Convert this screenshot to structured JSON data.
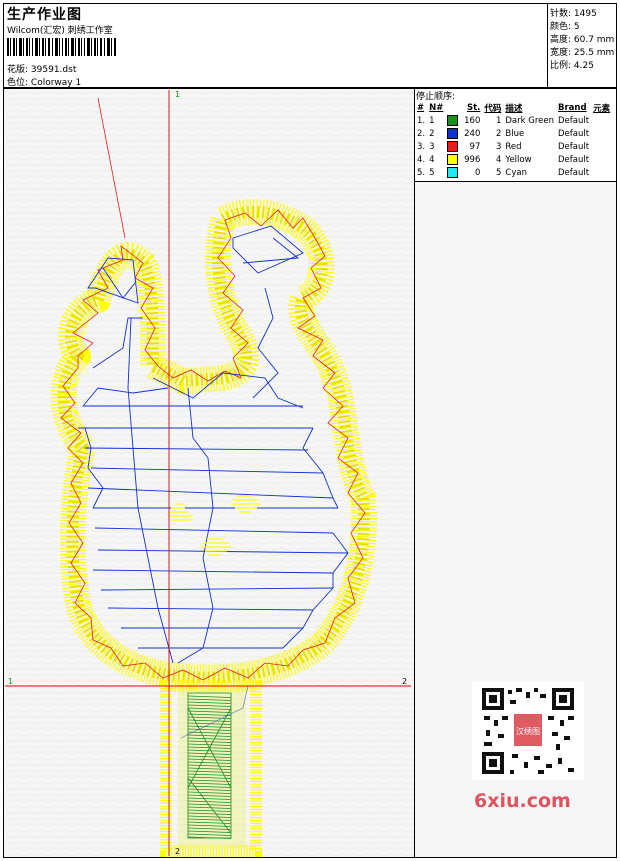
{
  "header": {
    "title": "生产作业图",
    "studio": "Wilcom(汇宏) 刺绣工作室",
    "design_label": "花版:",
    "design_file": "39591.dst",
    "colorway_label": "色位:",
    "colorway": "Colorway 1"
  },
  "stats": {
    "stitches": "针数: 1495",
    "colors": "颜色: 5",
    "height": "高度: 60.7 mm",
    "width": "宽度: 25.5 mm",
    "scale": "比例: 4.25"
  },
  "legend": {
    "title": "停止顺序:",
    "columns": [
      "#",
      "N#",
      "St.",
      "代码",
      "描述",
      "Brand",
      "元素"
    ],
    "rows": [
      {
        "idx": "1.",
        "n": "1",
        "color": "#1a8f1a",
        "st": "160",
        "code": "1",
        "desc": "Dark Green",
        "brand": "Default"
      },
      {
        "idx": "2.",
        "n": "2",
        "color": "#1030d0",
        "st": "240",
        "code": "2",
        "desc": "Blue",
        "brand": "Default"
      },
      {
        "idx": "3.",
        "n": "3",
        "color": "#ee1c1c",
        "st": "97",
        "code": "3",
        "desc": "Red",
        "brand": "Default"
      },
      {
        "idx": "4.",
        "n": "4",
        "color": "#ffff00",
        "st": "996",
        "code": "4",
        "desc": "Yellow",
        "brand": "Default"
      },
      {
        "idx": "5.",
        "n": "5",
        "color": "#22e8f0",
        "st": "0",
        "code": "5",
        "desc": "Cyan",
        "brand": "Default"
      }
    ]
  },
  "axes": {
    "top": "1",
    "bottom": "2",
    "left": "1",
    "right": "2"
  },
  "watermark": {
    "qr_text": "汉绣图",
    "brand": "6xiu.com"
  },
  "colors": {
    "green": "#1a8f1a",
    "blue": "#1030d0",
    "red": "#ee1c1c",
    "yellow": "#ffff00",
    "axis": "#e00000"
  }
}
